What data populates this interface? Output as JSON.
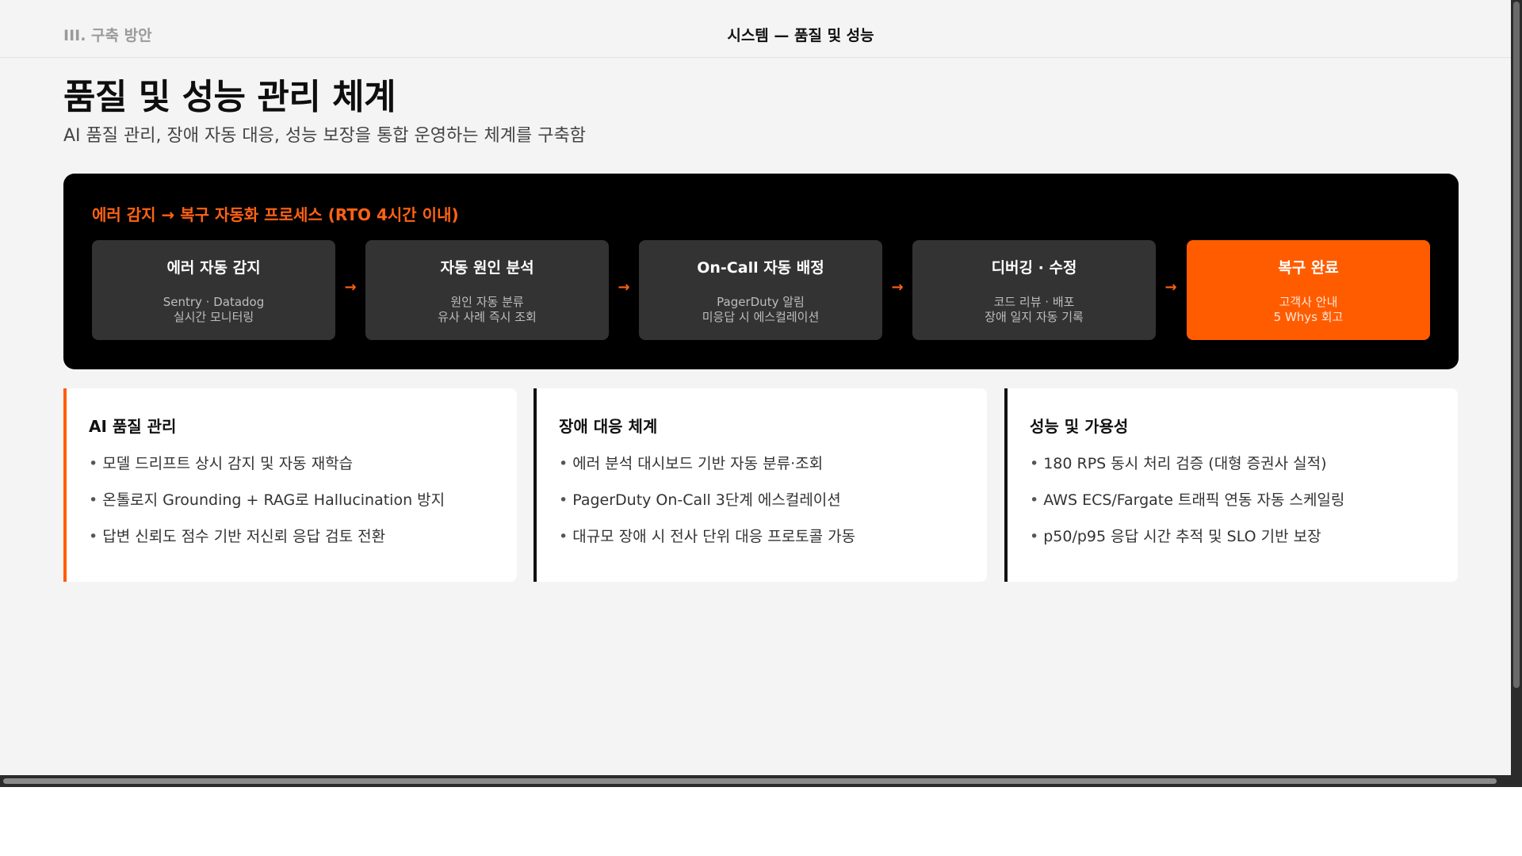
{
  "header": {
    "section_label": "III. 구축 방안",
    "title": "시스템 — 품질 및 성능"
  },
  "page": {
    "title": "품질 및 성능 관리 체계",
    "subtitle": "AI 품질 관리, 장애 자동 대응, 성능 보장을 통합 운영하는 체계를 구축함"
  },
  "process": {
    "title": "에러 감지 → 복구 자동화 프로세스 (RTO 4시간 이내)",
    "arrow": "→",
    "steps": [
      {
        "title": "에러 자동 감지",
        "line1": "Sentry · Datadog",
        "line2": "실시간 모니터링"
      },
      {
        "title": "자동 원인 분석",
        "line1": "원인 자동 분류",
        "line2": "유사 사례 즉시 조회"
      },
      {
        "title": "On-Call 자동 배정",
        "line1": "PagerDuty 알림",
        "line2": "미응답 시 에스컬레이션"
      },
      {
        "title": "디버깅 · 수정",
        "line1": "코드 리뷰 · 배포",
        "line2": "장애 일지 자동 기록"
      },
      {
        "title": "복구 완료",
        "line1": "고객사 안내",
        "line2": "5 Whys 회고"
      }
    ]
  },
  "cards": [
    {
      "title": "AI 품질 관리",
      "accent": "#ff5c00",
      "items": [
        "모델 드리프트 상시 감지 및 자동 재학습",
        "온톨로지 Grounding + RAG로 Hallucination 방지",
        "답변 신뢰도 점수 기반 저신뢰 응답 검토 전환"
      ]
    },
    {
      "title": "장애 대응 체계",
      "accent": "#111111",
      "items": [
        "에러 분석 대시보드 기반 자동 분류·조회",
        "PagerDuty On-Call 3단계 에스컬레이션",
        "대규모 장애 시 전사 단위 대응 프로토콜 가동"
      ]
    },
    {
      "title": "성능 및 가용성",
      "accent": "#111111",
      "items": [
        "180 RPS 동시 처리 검증 (대형 증권사 실적)",
        "AWS ECS/Fargate 트래픽 연동 자동 스케일링",
        "p50/p95 응답 시간 추적 및 SLO 기반 보장"
      ]
    }
  ],
  "bullet": "•"
}
